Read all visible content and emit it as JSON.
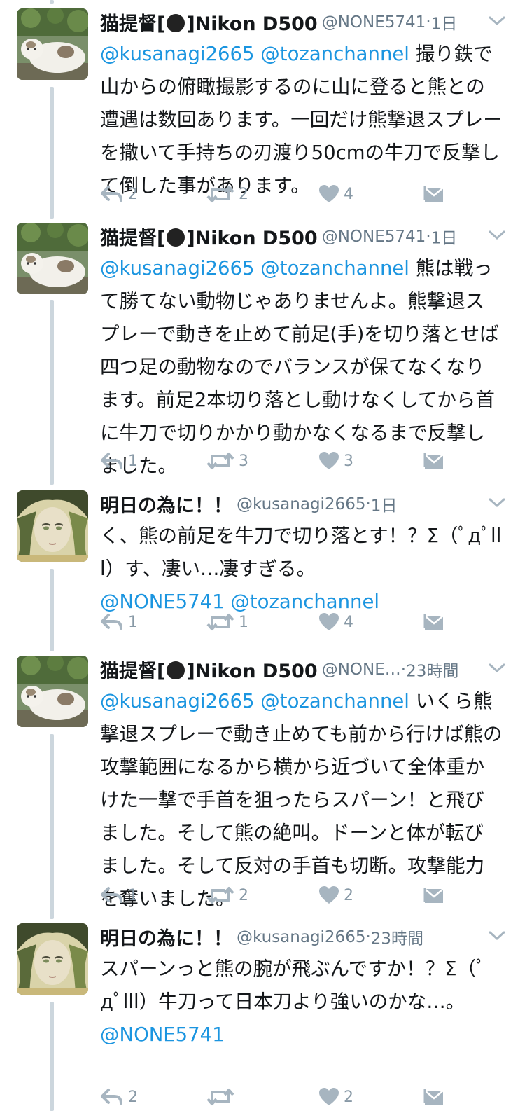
{
  "tweets": [
    {
      "name": "猫提督[",
      "name_suffix": "]Nikon D500",
      "handle": "@NONE5741",
      "sep": "·",
      "time": "1日",
      "mentions": "@kusanagi2665 @tozanchannel",
      "text": "撮り鉄で山からの俯瞰撮影するのに山に登ると熊との遭遇は数回あります。一回だけ熊撃退スプレーを撒いて手持ちの刃渡り50cmの牛刀で反撃して倒した事があります。",
      "trailing_mentions": "",
      "reply": "2",
      "retweet": "2",
      "like": "4",
      "avatar_icon": "cat-avatar"
    },
    {
      "name": "猫提督[",
      "name_suffix": "]Nikon D500",
      "handle": "@NONE5741",
      "sep": "·",
      "time": "1日",
      "mentions": "@kusanagi2665 @tozanchannel",
      "text": "熊は戦って勝てない動物じゃありませんよ。熊撃退スプレーで動きを止めて前足(手)を切り落とせば四つ足の動物なのでバランスが保てなくなります。前足2本切り落とし動けなくしてから首に牛刀で切りかかり動かなくなるまで反撃しました。",
      "trailing_mentions": "",
      "reply": "1",
      "retweet": "3",
      "like": "3",
      "avatar_icon": "cat-avatar"
    },
    {
      "name": "明日の為に！！",
      "name_suffix": "",
      "handle": "@kusanagi2665",
      "sep": "·",
      "time": "1日",
      "mentions": "",
      "text": "く、熊の前足を牛刀で切り落とす！？Σ（ﾟдﾟlll）す、凄い…凄すぎる。",
      "trailing_mentions": "@NONE5741 @tozanchannel",
      "reply": "1",
      "retweet": "1",
      "like": "4",
      "avatar_icon": "illustrated-face-avatar"
    },
    {
      "name": "猫提督[",
      "name_suffix": "]Nikon D500",
      "handle": "@NONE…",
      "sep": "·",
      "time": "23時間",
      "mentions": "@kusanagi2665 @tozanchannel",
      "text": "いくら熊撃退スプレーで動き止めても前から行けば熊の攻撃範囲になるから横から近づいて全体重かけた一撃で手首を狙ったらスパーン！と飛びました。そして熊の絶叫。ドーンと体が転びました。そして反対の手首も切断。攻撃能力を奪いました。",
      "trailing_mentions": "",
      "reply": "1",
      "retweet": "2",
      "like": "2",
      "avatar_icon": "cat-avatar"
    },
    {
      "name": "明日の為に！！",
      "name_suffix": "",
      "handle": "@kusanagi2665",
      "sep": "·",
      "time": "23時間",
      "mentions": "",
      "text": "スパーンっと熊の腕が飛ぶんですか！？Σ（ﾟдﾟlll）牛刀って日本刀より強いのかな…。",
      "trailing_mentions": "@NONE5741",
      "reply": "2",
      "retweet": "",
      "like": "2",
      "avatar_icon": "illustrated-face-avatar"
    }
  ],
  "colors": {
    "link": "#1b95e0",
    "meta": "#657786",
    "icon": "#a7b5c0",
    "thread": "#ccd6dd"
  }
}
